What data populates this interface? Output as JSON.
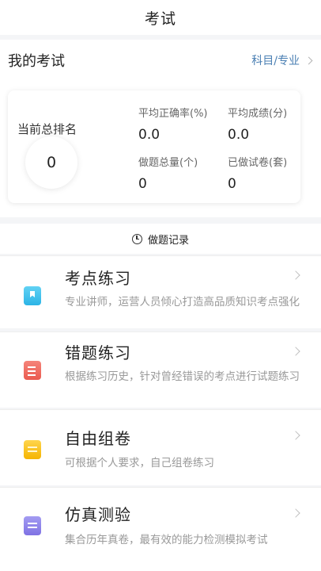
{
  "header": {
    "title": "考试"
  },
  "my_exam": {
    "title": "我的考试",
    "subject_link": "科目/专业"
  },
  "stats": {
    "rank_label": "当前总排名",
    "rank_value": "0",
    "avg_accuracy_label": "平均正确率(%)",
    "avg_accuracy_value": "0.0",
    "avg_score_label": "平均成绩(分)",
    "avg_score_value": "0.0",
    "total_questions_label": "做题总量(个)",
    "total_questions_value": "0",
    "papers_done_label": "已做试卷(套)",
    "papers_done_value": "0"
  },
  "record": {
    "label": "做题记录",
    "icon": "clock-icon"
  },
  "menu": [
    {
      "title": "考点练习",
      "desc": "专业讲师，运营人员倾心打造高品质知识考点强化",
      "icon": "book-icon",
      "color": "#2cb4e6"
    },
    {
      "title": "错题练习",
      "desc": "根据练习历史，针对曾经错误的考点进行试题练习",
      "icon": "edit-doc-icon",
      "color": "#ea5b50"
    },
    {
      "title": "自由组卷",
      "desc": "可根据个人要求，自己组卷练习",
      "icon": "folder-icon",
      "color": "#f5b400"
    },
    {
      "title": "仿真测验",
      "desc": "集合历年真卷，最有效的能力检测模拟考试",
      "icon": "note-icon",
      "color": "#7f72e3"
    }
  ]
}
